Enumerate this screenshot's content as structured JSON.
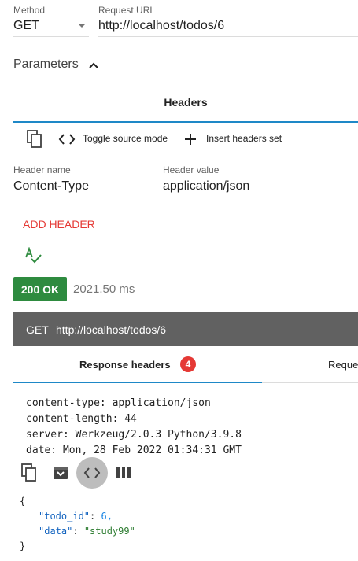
{
  "request": {
    "method_label": "Method",
    "method_value": "GET",
    "url_label": "Request URL",
    "url_value": "http://localhost/todos/6"
  },
  "parameters": {
    "title": "Parameters",
    "tab_label": "Headers"
  },
  "headers_toolbar": {
    "toggle_source_label": "Toggle source mode",
    "insert_set_label": "Insert headers set"
  },
  "header_row": {
    "name_label": "Header name",
    "name_value": "Content-Type",
    "value_label": "Header value",
    "value_value": "application/json"
  },
  "add_header_label": "ADD HEADER",
  "status": {
    "badge": "200 OK",
    "time": "2021.50 ms",
    "badge_color": "#2e8b3f"
  },
  "response_bar": {
    "method": "GET",
    "url": "http://localhost/todos/6"
  },
  "response_tabs": {
    "headers_label": "Response headers",
    "headers_count": "4",
    "request_label": "Reque",
    "accent_color": "#1e88c7",
    "badge_color": "#e53935"
  },
  "response_headers": [
    "content-type: application/json",
    "content-length: 44",
    "server: Werkzeug/2.0.3 Python/3.9.8",
    "date: Mon, 28 Feb 2022 01:34:31 GMT"
  ],
  "body_json": {
    "open_brace": "{",
    "key1": "\"todo_id\"",
    "val1": "6,",
    "key2": "\"data\"",
    "val2": "\"study99\"",
    "close_brace": "}"
  }
}
